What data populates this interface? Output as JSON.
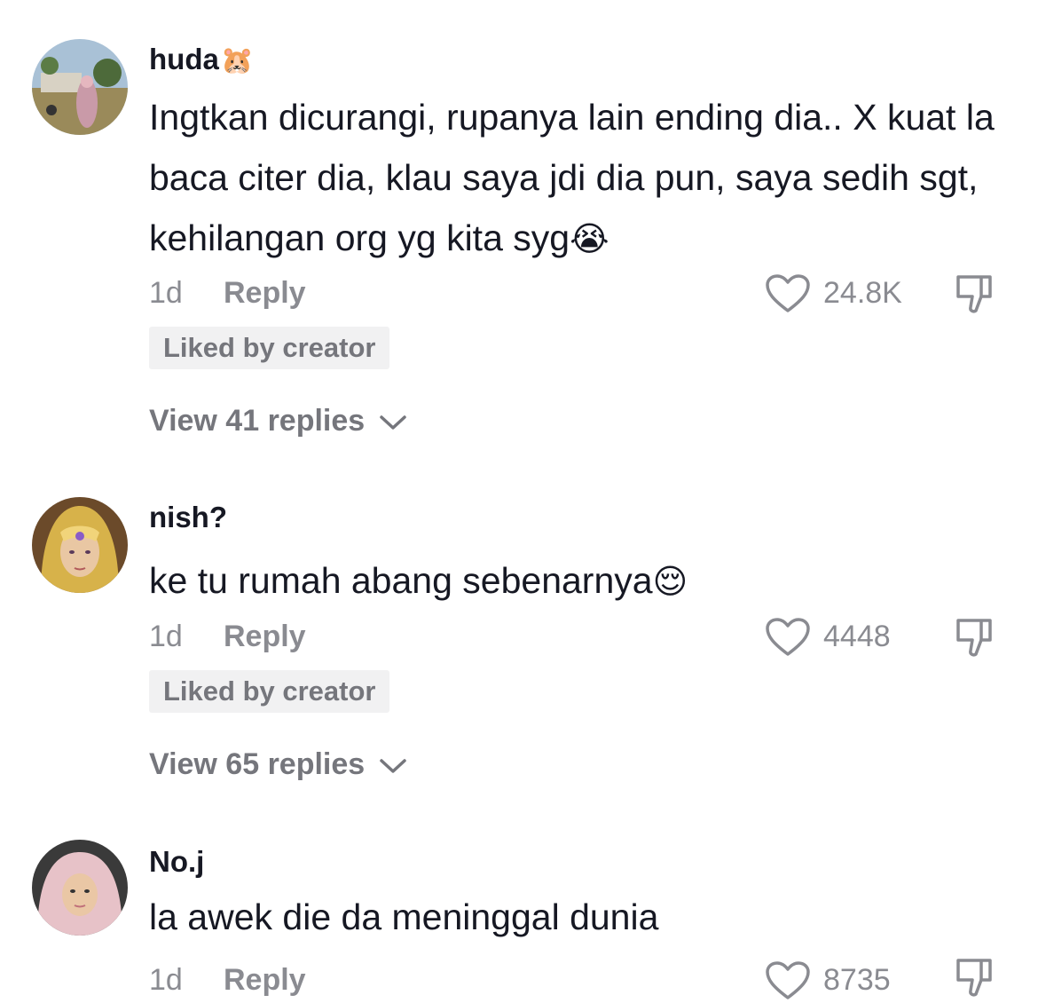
{
  "comments": [
    {
      "username": "huda",
      "username_emoji": "🐹",
      "text": "Ingtkan dicurangi, rupanya lain ending dia.. X kuat la baca citer dia, klau saya jdi dia pun, saya sedih sgt, kehilangan org yg kita syg",
      "text_emoji": "😭",
      "time": "1d",
      "reply_label": "Reply",
      "likes": "24.8K",
      "badge": "Liked by creator",
      "view_replies": "View 41 replies"
    },
    {
      "username": "nish?",
      "text": "ke tu rumah abang sebenarnya",
      "text_emoji": "😌",
      "time": "1d",
      "reply_label": "Reply",
      "likes": "4448",
      "badge": "Liked by creator",
      "view_replies": "View 65 replies"
    },
    {
      "username": "No.j",
      "text": "la awek die da meninggal dunia",
      "time": "1d",
      "reply_label": "Reply",
      "likes": "8735"
    }
  ],
  "icons": {
    "like": "heart-outline-icon",
    "dislike": "thumbs-down-icon",
    "expand": "chevron-down-icon"
  },
  "colors": {
    "primary_text": "#161823",
    "secondary_text": "#8a8b91",
    "badge_bg": "#f1f1f2"
  }
}
